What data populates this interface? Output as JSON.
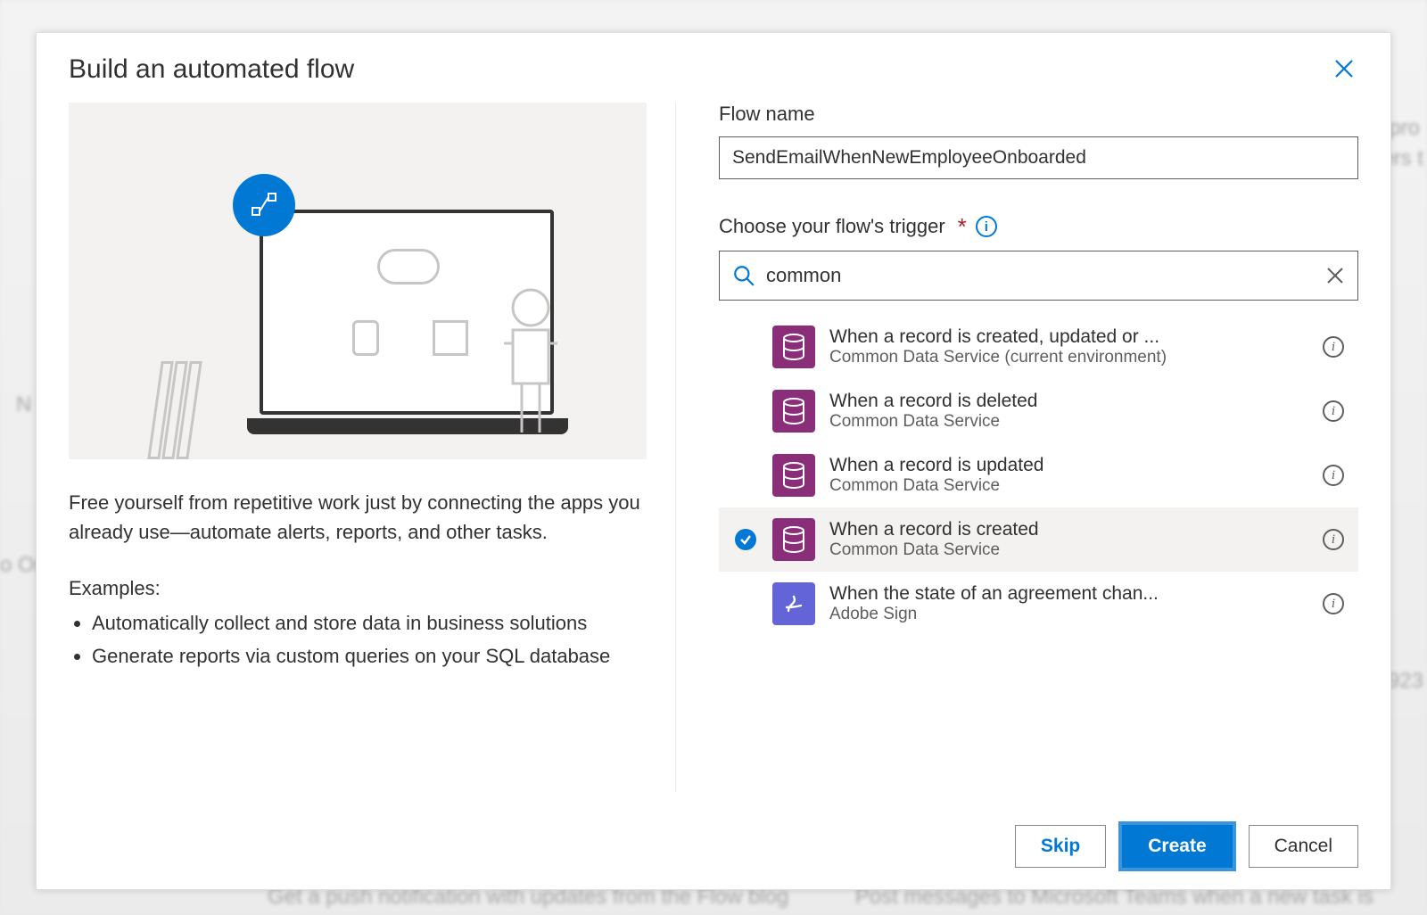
{
  "modal": {
    "title": "Build an automated flow",
    "illustration_alt": "automation-illustration"
  },
  "left": {
    "paragraph": "Free yourself from repetitive work just by connecting the apps you already use—automate alerts, reports, and other tasks.",
    "examples_label": "Examples:",
    "examples": [
      "Automatically collect and store data in business solutions",
      "Generate reports via custom queries on your SQL database"
    ]
  },
  "right": {
    "flow_name_label": "Flow name",
    "flow_name_value": "SendEmailWhenNewEmployeeOnboarded",
    "trigger_label": "Choose your flow's trigger",
    "search_value": "common",
    "triggers": [
      {
        "title": "When a record is created, updated or ...",
        "subtitle": "Common Data Service (current environment)",
        "service": "cds",
        "selected": false
      },
      {
        "title": "When a record is deleted",
        "subtitle": "Common Data Service",
        "service": "cds",
        "selected": false
      },
      {
        "title": "When a record is updated",
        "subtitle": "Common Data Service",
        "service": "cds",
        "selected": false
      },
      {
        "title": "When a record is created",
        "subtitle": "Common Data Service",
        "service": "cds",
        "selected": true
      },
      {
        "title": "When the state of an agreement chan...",
        "subtitle": "Adobe Sign",
        "service": "adobe",
        "selected": false
      }
    ]
  },
  "footer": {
    "skip": "Skip",
    "create": "Create",
    "cancel": "Cancel"
  },
  "bg": {
    "frag1": "pro",
    "frag2": "ers t",
    "frag3": "N",
    "frag4": "o On",
    "frag5": "923",
    "frag6": "Get a push notification with updates from the Flow blog",
    "frag7": "Post messages to Microsoft Teams when a new task is"
  }
}
